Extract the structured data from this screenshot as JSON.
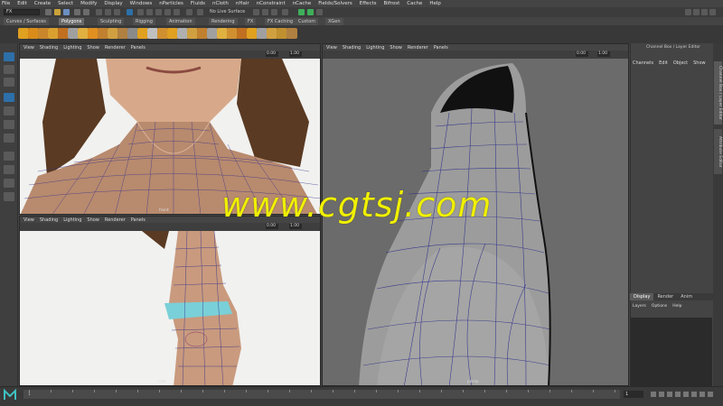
{
  "menubar": [
    "File",
    "Edit",
    "Create",
    "Select",
    "Modify",
    "Display",
    "Windows",
    "nParticles",
    "Fluids",
    "nCloth",
    "nHair",
    "nConstraint",
    "nCache",
    "Fields/Solvers",
    "Effects",
    "Bifrost",
    "Cache",
    "Help"
  ],
  "status": {
    "mode": "FX",
    "live_surface": "No Live Surface"
  },
  "shelf_tabs": [
    "Curves / Surfaces",
    "Polygons",
    "Sculpting",
    "Rigging",
    "Animation",
    "Rendering",
    "FX",
    "FX Caching",
    "Custom",
    "XGen"
  ],
  "active_shelf_tab": "Polygons",
  "viewport_menu": [
    "View",
    "Shading",
    "Lighting",
    "Show",
    "Renderer",
    "Panels"
  ],
  "viewport_fields": {
    "value_a": "0.00",
    "value_b": "1.00"
  },
  "viewports": {
    "front": {
      "camera": "front"
    },
    "side": {
      "camera": "side"
    },
    "persp": {
      "camera": "persp"
    }
  },
  "channel_box": {
    "title": "Channel Box / Layer Editor",
    "menu": [
      "Channels",
      "Edit",
      "Object",
      "Show"
    ],
    "side_tabs": [
      "Channel Box / Layer Editor",
      "Attribute Editor"
    ]
  },
  "layer_editor": {
    "tabs": [
      "Display",
      "Render",
      "Anim"
    ],
    "active_tab": "Display",
    "menu": [
      "Layers",
      "Options",
      "Help"
    ]
  },
  "timeline": {
    "ticks": [
      "1",
      "",
      "",
      "",
      "",
      "",
      "",
      "",
      "",
      "",
      "",
      "",
      "",
      "",
      "",
      "",
      "",
      "",
      "",
      "",
      "",
      "",
      "",
      "",
      "",
      "",
      "",
      ""
    ],
    "current_frame": "1"
  },
  "watermark": "www.cgtsj.com",
  "colors": {
    "accent": "#2d6fa8",
    "shelf_green": "#3fae5a",
    "watermark": "#f0f000",
    "wire": "#2a2a8a"
  }
}
